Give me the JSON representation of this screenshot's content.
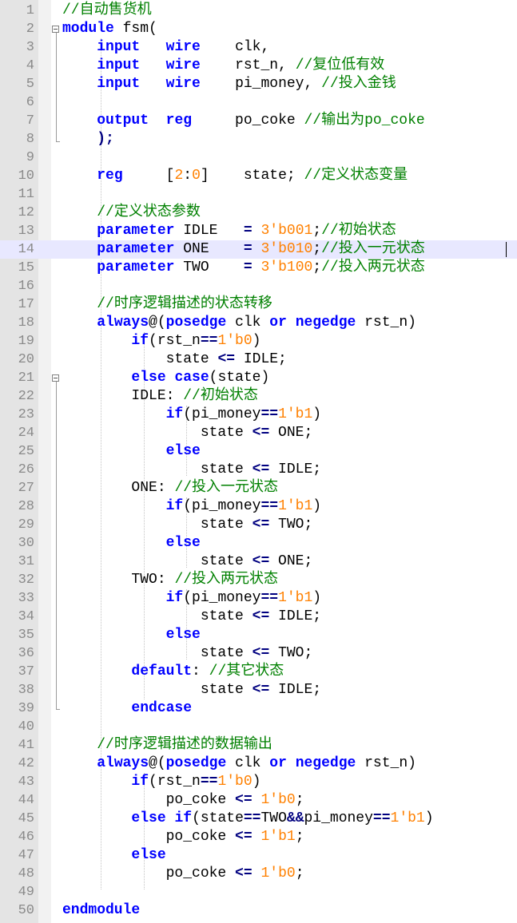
{
  "editor": {
    "current_line": 14,
    "lines": [
      [
        [
          "cm",
          "//自动售货机"
        ]
      ],
      [
        [
          "kw",
          "module"
        ],
        [
          "t",
          " fsm("
        ]
      ],
      [
        [
          "t",
          "    "
        ],
        [
          "kw",
          "input"
        ],
        [
          "t",
          "   "
        ],
        [
          "kw",
          "wire"
        ],
        [
          "t",
          "    clk,"
        ]
      ],
      [
        [
          "t",
          "    "
        ],
        [
          "kw",
          "input"
        ],
        [
          "t",
          "   "
        ],
        [
          "kw",
          "wire"
        ],
        [
          "t",
          "    rst_n, "
        ],
        [
          "cm",
          "//复位低有效"
        ]
      ],
      [
        [
          "t",
          "    "
        ],
        [
          "kw",
          "input"
        ],
        [
          "t",
          "   "
        ],
        [
          "kw",
          "wire"
        ],
        [
          "t",
          "    pi_money, "
        ],
        [
          "cm",
          "//投入金钱"
        ]
      ],
      [],
      [
        [
          "t",
          "    "
        ],
        [
          "kw",
          "output"
        ],
        [
          "t",
          "  "
        ],
        [
          "kw",
          "reg"
        ],
        [
          "t",
          "     po_coke "
        ],
        [
          "cm",
          "//输出为po_coke"
        ]
      ],
      [
        [
          "t",
          "    "
        ],
        [
          "op",
          ");"
        ]
      ],
      [],
      [
        [
          "t",
          "    "
        ],
        [
          "kw",
          "reg"
        ],
        [
          "t",
          "     ["
        ],
        [
          "num",
          "2"
        ],
        [
          "t",
          ":"
        ],
        [
          "num",
          "0"
        ],
        [
          "t",
          "]    state; "
        ],
        [
          "cm",
          "//定义状态变量"
        ]
      ],
      [],
      [
        [
          "t",
          "    "
        ],
        [
          "cm",
          "//定义状态参数"
        ]
      ],
      [
        [
          "t",
          "    "
        ],
        [
          "kw",
          "parameter"
        ],
        [
          "t",
          " IDLE   "
        ],
        [
          "op",
          "="
        ],
        [
          "t",
          " "
        ],
        [
          "num",
          "3'b001"
        ],
        [
          "t",
          ";"
        ],
        [
          "cm",
          "//初始状态"
        ]
      ],
      [
        [
          "t",
          "    "
        ],
        [
          "kw",
          "parameter"
        ],
        [
          "t",
          " ONE    "
        ],
        [
          "op",
          "="
        ],
        [
          "t",
          " "
        ],
        [
          "num",
          "3'b010"
        ],
        [
          "t",
          ";"
        ],
        [
          "cm",
          "//投入一元状态"
        ]
      ],
      [
        [
          "t",
          "    "
        ],
        [
          "kw",
          "parameter"
        ],
        [
          "t",
          " TWO    "
        ],
        [
          "op",
          "="
        ],
        [
          "t",
          " "
        ],
        [
          "num",
          "3'b100"
        ],
        [
          "t",
          ";"
        ],
        [
          "cm",
          "//投入两元状态"
        ]
      ],
      [],
      [
        [
          "t",
          "    "
        ],
        [
          "cm",
          "//时序逻辑描述的状态转移"
        ]
      ],
      [
        [
          "t",
          "    "
        ],
        [
          "kw",
          "always"
        ],
        [
          "t",
          "@("
        ],
        [
          "kw",
          "posedge"
        ],
        [
          "t",
          " clk "
        ],
        [
          "kw",
          "or"
        ],
        [
          "t",
          " "
        ],
        [
          "kw",
          "negedge"
        ],
        [
          "t",
          " rst_n)"
        ]
      ],
      [
        [
          "t",
          "        "
        ],
        [
          "kw",
          "if"
        ],
        [
          "t",
          "(rst_n"
        ],
        [
          "op",
          "=="
        ],
        [
          "num",
          "1'b0"
        ],
        [
          "t",
          ")"
        ]
      ],
      [
        [
          "t",
          "            state "
        ],
        [
          "op",
          "<="
        ],
        [
          "t",
          " IDLE;"
        ]
      ],
      [
        [
          "t",
          "        "
        ],
        [
          "kw",
          "else"
        ],
        [
          "t",
          " "
        ],
        [
          "kw",
          "case"
        ],
        [
          "t",
          "(state)"
        ]
      ],
      [
        [
          "t",
          "        IDLE: "
        ],
        [
          "cm",
          "//初始状态"
        ]
      ],
      [
        [
          "t",
          "            "
        ],
        [
          "kw",
          "if"
        ],
        [
          "t",
          "(pi_money"
        ],
        [
          "op",
          "=="
        ],
        [
          "num",
          "1'b1"
        ],
        [
          "t",
          ")"
        ]
      ],
      [
        [
          "t",
          "                state "
        ],
        [
          "op",
          "<="
        ],
        [
          "t",
          " ONE;"
        ]
      ],
      [
        [
          "t",
          "            "
        ],
        [
          "kw",
          "else"
        ]
      ],
      [
        [
          "t",
          "                state "
        ],
        [
          "op",
          "<="
        ],
        [
          "t",
          " IDLE;"
        ]
      ],
      [
        [
          "t",
          "        ONE: "
        ],
        [
          "cm",
          "//投入一元状态"
        ]
      ],
      [
        [
          "t",
          "            "
        ],
        [
          "kw",
          "if"
        ],
        [
          "t",
          "(pi_money"
        ],
        [
          "op",
          "=="
        ],
        [
          "num",
          "1'b1"
        ],
        [
          "t",
          ")"
        ]
      ],
      [
        [
          "t",
          "                state "
        ],
        [
          "op",
          "<="
        ],
        [
          "t",
          " TWO;"
        ]
      ],
      [
        [
          "t",
          "            "
        ],
        [
          "kw",
          "else"
        ]
      ],
      [
        [
          "t",
          "                state "
        ],
        [
          "op",
          "<="
        ],
        [
          "t",
          " ONE;"
        ]
      ],
      [
        [
          "t",
          "        TWO: "
        ],
        [
          "cm",
          "//投入两元状态"
        ]
      ],
      [
        [
          "t",
          "            "
        ],
        [
          "kw",
          "if"
        ],
        [
          "t",
          "(pi_money"
        ],
        [
          "op",
          "=="
        ],
        [
          "num",
          "1'b1"
        ],
        [
          "t",
          ")"
        ]
      ],
      [
        [
          "t",
          "                state "
        ],
        [
          "op",
          "<="
        ],
        [
          "t",
          " IDLE;"
        ]
      ],
      [
        [
          "t",
          "            "
        ],
        [
          "kw",
          "else"
        ]
      ],
      [
        [
          "t",
          "                state "
        ],
        [
          "op",
          "<="
        ],
        [
          "t",
          " TWO;"
        ]
      ],
      [
        [
          "t",
          "        "
        ],
        [
          "kw",
          "default"
        ],
        [
          "t",
          ": "
        ],
        [
          "cm",
          "//其它状态"
        ]
      ],
      [
        [
          "t",
          "                state "
        ],
        [
          "op",
          "<="
        ],
        [
          "t",
          " IDLE;"
        ]
      ],
      [
        [
          "t",
          "        "
        ],
        [
          "kw",
          "endcase"
        ]
      ],
      [],
      [
        [
          "t",
          "    "
        ],
        [
          "cm",
          "//时序逻辑描述的数据输出"
        ]
      ],
      [
        [
          "t",
          "    "
        ],
        [
          "kw",
          "always"
        ],
        [
          "t",
          "@("
        ],
        [
          "kw",
          "posedge"
        ],
        [
          "t",
          " clk "
        ],
        [
          "kw",
          "or"
        ],
        [
          "t",
          " "
        ],
        [
          "kw",
          "negedge"
        ],
        [
          "t",
          " rst_n)"
        ]
      ],
      [
        [
          "t",
          "        "
        ],
        [
          "kw",
          "if"
        ],
        [
          "t",
          "(rst_n"
        ],
        [
          "op",
          "=="
        ],
        [
          "num",
          "1'b0"
        ],
        [
          "t",
          ")"
        ]
      ],
      [
        [
          "t",
          "            po_coke "
        ],
        [
          "op",
          "<="
        ],
        [
          "t",
          " "
        ],
        [
          "num",
          "1'b0"
        ],
        [
          "t",
          ";"
        ]
      ],
      [
        [
          "t",
          "        "
        ],
        [
          "kw",
          "else"
        ],
        [
          "t",
          " "
        ],
        [
          "kw",
          "if"
        ],
        [
          "t",
          "(state"
        ],
        [
          "op",
          "=="
        ],
        [
          "t",
          "TWO"
        ],
        [
          "op",
          "&&"
        ],
        [
          "t",
          "pi_money"
        ],
        [
          "op",
          "=="
        ],
        [
          "num",
          "1'b1"
        ],
        [
          "t",
          ")"
        ]
      ],
      [
        [
          "t",
          "            po_coke "
        ],
        [
          "op",
          "<="
        ],
        [
          "t",
          " "
        ],
        [
          "num",
          "1'b1"
        ],
        [
          "t",
          ";"
        ]
      ],
      [
        [
          "t",
          "        "
        ],
        [
          "kw",
          "else"
        ]
      ],
      [
        [
          "t",
          "            po_coke "
        ],
        [
          "op",
          "<="
        ],
        [
          "t",
          " "
        ],
        [
          "num",
          "1'b0"
        ],
        [
          "t",
          ";"
        ]
      ],
      [],
      [
        [
          "kw",
          "endmodule"
        ]
      ]
    ]
  }
}
